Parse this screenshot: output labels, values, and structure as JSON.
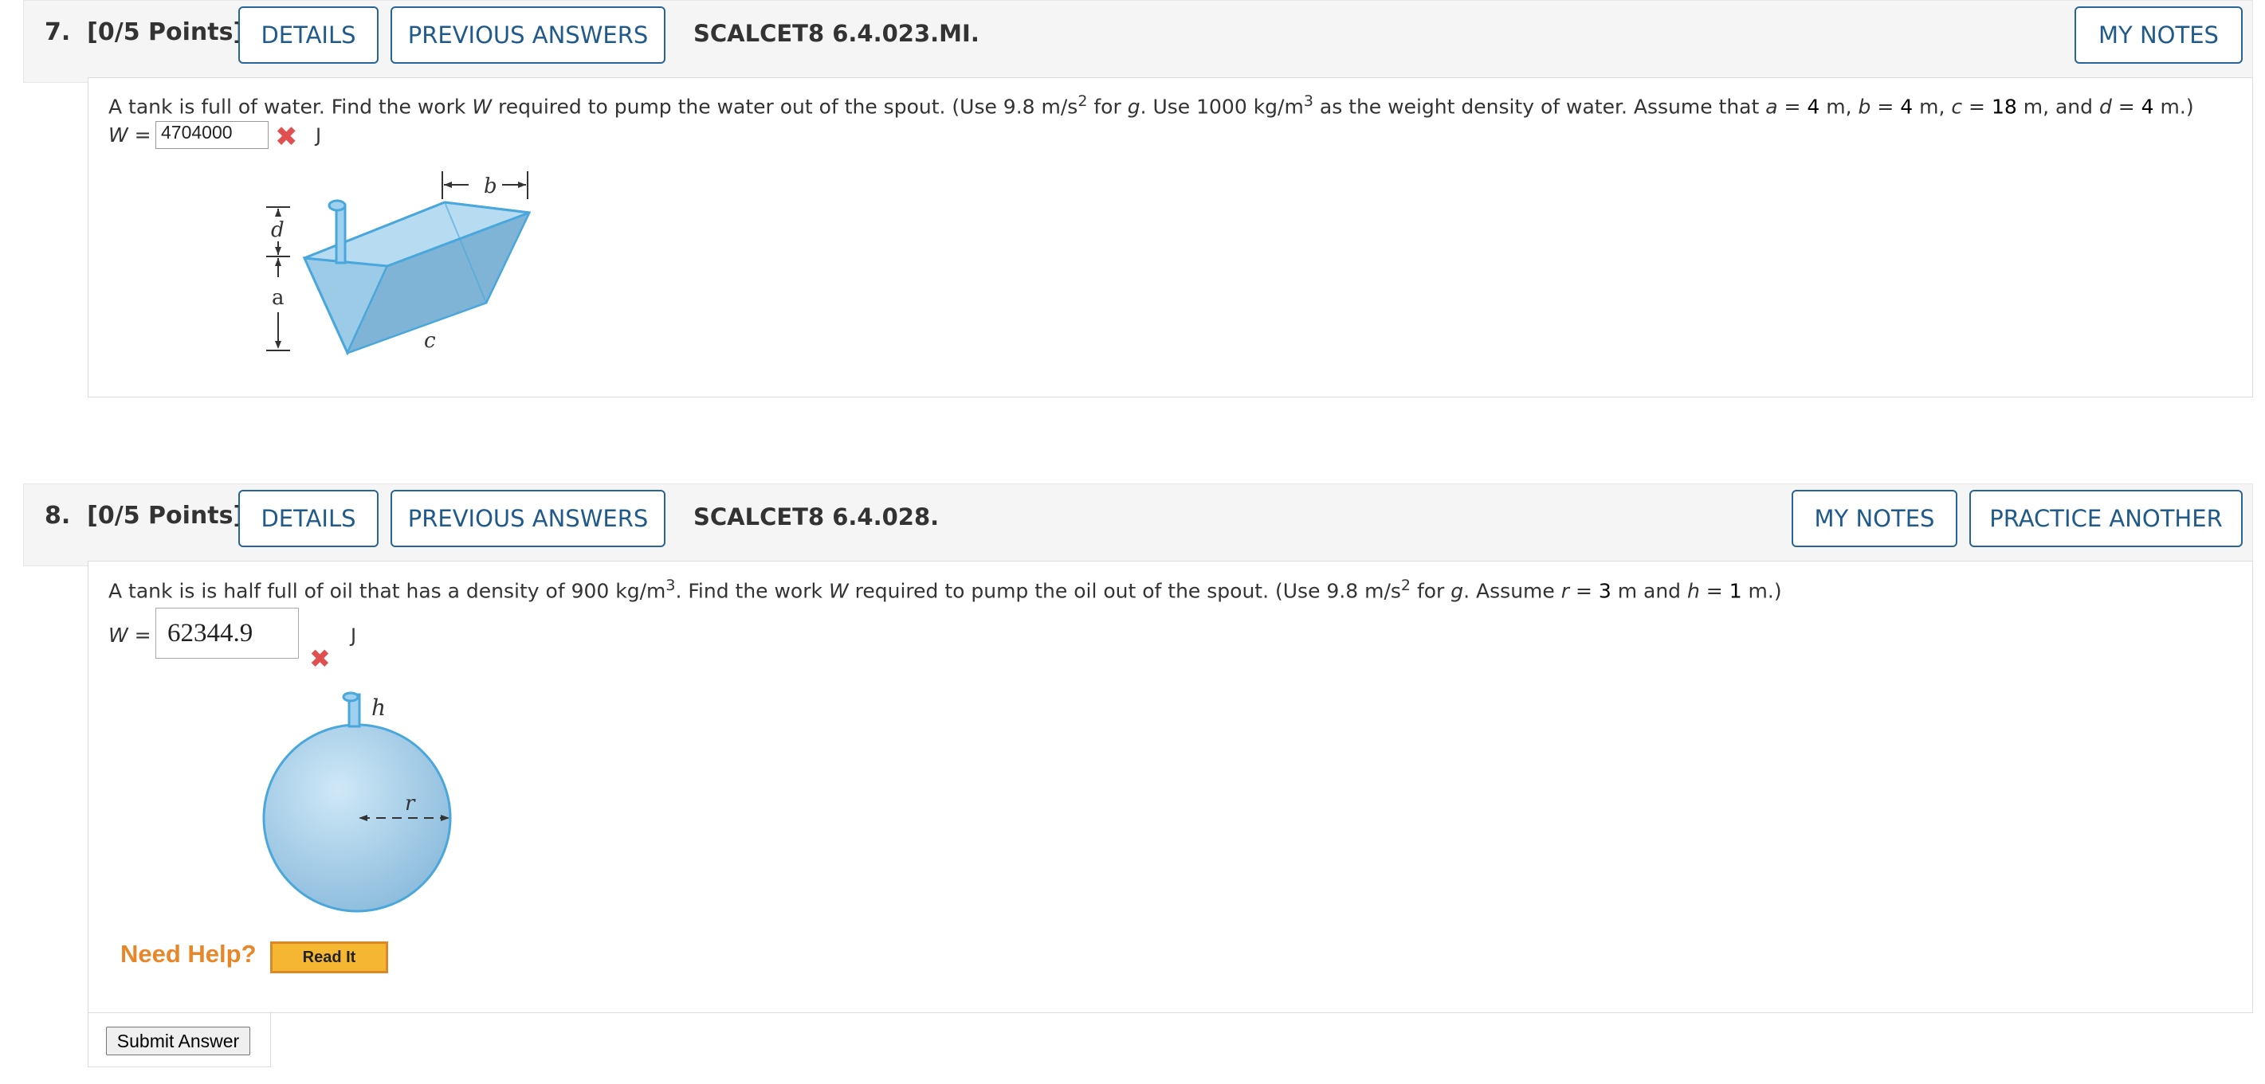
{
  "colors": {
    "link": "#1f5a8b",
    "error": "#e05050",
    "help": "#e8862a"
  },
  "q7": {
    "number": "7.",
    "points": "[0/5 Points]",
    "details_label": "DETAILS",
    "prev_answers_label": "PREVIOUS ANSWERS",
    "code": "SCALCET8 6.4.023.MI.",
    "notes_label": "MY NOTES",
    "prompt": {
      "p1": "A tank is full of water. Find the work ",
      "W": "W",
      "p2": " required to pump the water out of the spout. (Use 9.8 m/s",
      "sup1": "2",
      "p3": " for ",
      "g": "g",
      "p4": ". Use 1000 kg/m",
      "sup2": "3",
      "p5": " as the weight density of water. Assume that ",
      "a": "a",
      "p6": " = ",
      "a_val": "4",
      "p7": " m, ",
      "b": "b",
      "p8": " = ",
      "b_val": "4",
      "p9": " m, ",
      "c": "c",
      "p10": " = ",
      "c_val": "18",
      "p11": " m, and ",
      "d": "d",
      "p12": " = ",
      "d_val": "4",
      "p13": " m.)"
    },
    "w_label": "W =",
    "answer": "4704000",
    "unit": "J",
    "figure_labels": {
      "b": "b",
      "d": "d",
      "a": "a",
      "c": "c"
    }
  },
  "q8": {
    "number": "8.",
    "points": "[0/5 Points]",
    "details_label": "DETAILS",
    "prev_answers_label": "PREVIOUS ANSWERS",
    "code": "SCALCET8 6.4.028.",
    "notes_label": "MY NOTES",
    "practice_label": "PRACTICE ANOTHER",
    "prompt": {
      "p1": "A tank is is half full of oil that has a density of 900 kg/m",
      "sup1": "3",
      "p2": ". Find the work ",
      "W": "W",
      "p3": " required to pump the oil out of the spout. (Use 9.8 m/s",
      "sup2": "2",
      "p4": " for ",
      "g": "g",
      "p5": ". Assume ",
      "r": "r",
      "p6": " = ",
      "r_val": "3",
      "p7": " m and ",
      "h": "h",
      "p8": " = ",
      "h_val": "1",
      "p9": " m.)"
    },
    "w_label": "W =",
    "answer": "62344.9",
    "unit": "J",
    "figure_labels": {
      "h": "h",
      "r": "r"
    },
    "need_help": "Need Help?",
    "read_it": "Read It",
    "submit": "Submit Answer"
  }
}
